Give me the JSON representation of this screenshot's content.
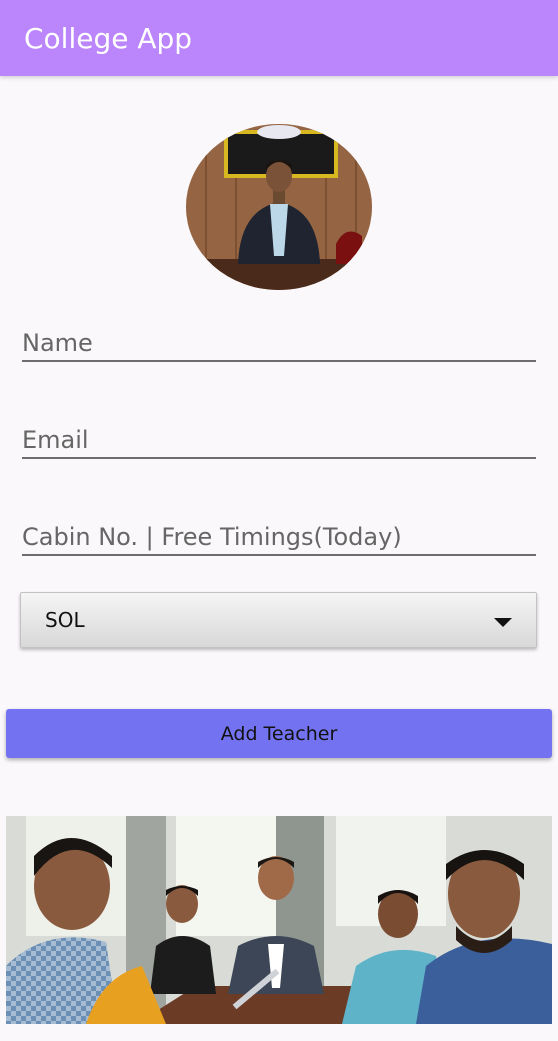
{
  "app_bar": {
    "title": "College App",
    "color": "#bb86fc"
  },
  "form": {
    "avatar_icon": "teacher-photo",
    "name_placeholder": "Name",
    "email_placeholder": "Email",
    "cabin_placeholder": "Cabin No. | Free Timings(Today)",
    "department_selected": "SOL",
    "submit_label": "Add Teacher",
    "submit_color": "#7373f2"
  },
  "banner": {
    "image": "meeting-photo"
  }
}
